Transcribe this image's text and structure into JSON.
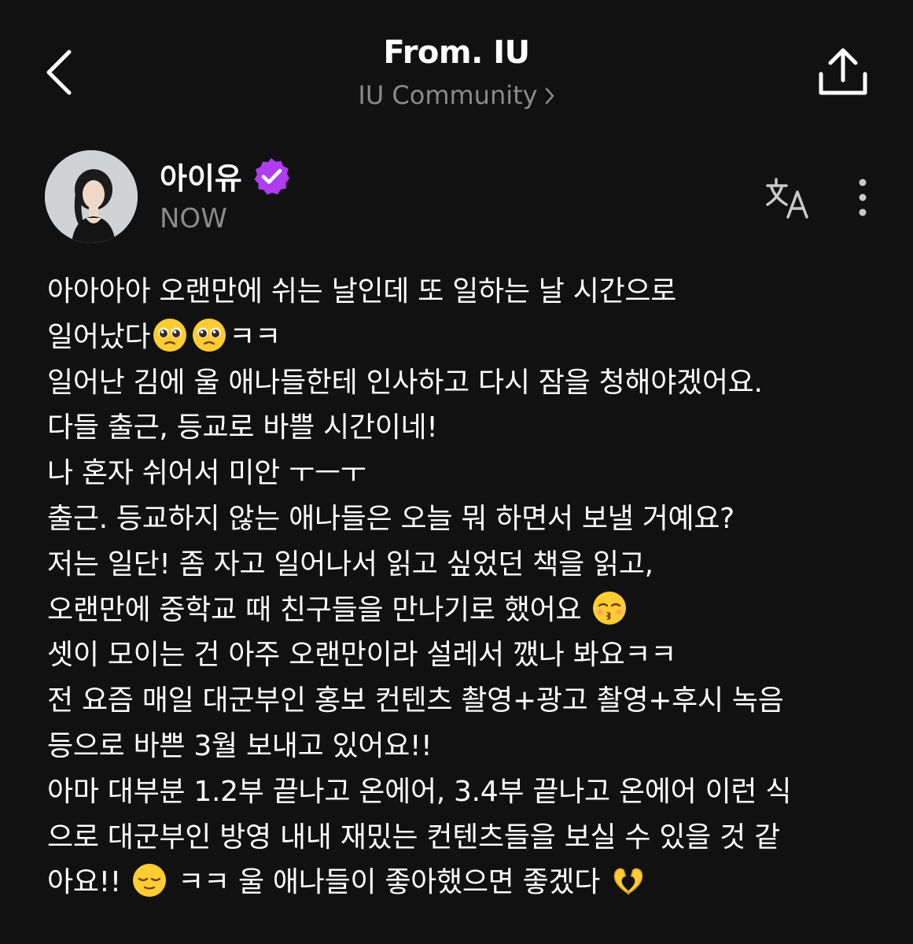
{
  "header": {
    "title": "From. IU",
    "subtitle": "IU Community",
    "back_icon": "chevron-left-icon",
    "share_icon": "share-icon"
  },
  "post": {
    "author": "아이유",
    "time": "NOW",
    "verified_color": "#b03cf0",
    "lines": [
      {
        "segments": [
          "아아아아 오랜만에 쉬는 날인데 또 일하는 날 시간으로"
        ]
      },
      {
        "segments": [
          "일어났다",
          "🥹",
          "🥹",
          "ㅋㅋ"
        ]
      },
      {
        "segments": [
          "일어난 김에 울 애나들한테 인사하고 다시 잠을 청해야겠어요."
        ]
      },
      {
        "segments": [
          "다들 출근, 등교로 바쁠 시간이네!"
        ]
      },
      {
        "segments": [
          "나 혼자 쉬어서 미안 ㅜㅡㅜ"
        ]
      },
      {
        "segments": [
          "출근. 등교하지 않는 애나들은 오늘 뭐 하면서 보낼 거예요?"
        ]
      },
      {
        "segments": [
          "저는 일단! 좀 자고 일어나서 읽고 싶었던 책을 읽고,"
        ]
      },
      {
        "segments": [
          "오랜만에 중학교 때 친구들을 만나기로 했어요 ",
          "😚"
        ]
      },
      {
        "segments": [
          "셋이 모이는 건 아주 오랜만이라 설레서 깼나 봐요ㅋㅋ"
        ]
      },
      {
        "segments": [
          "전 요즘 매일 대군부인 홍보 컨텐츠 촬영+광고 촬영+후시 녹음"
        ]
      },
      {
        "segments": [
          "등으로 바쁜 3월 보내고 있어요!!"
        ]
      },
      {
        "segments": [
          "아마 대부분 1.2부 끝나고 온에어, 3.4부 끝나고 온에어 이런 식"
        ]
      },
      {
        "segments": [
          "으로 대군부인 방영 내내 재밌는 컨텐츠들을 보실 수 있을 것 같"
        ]
      },
      {
        "segments": [
          "아요!! ",
          "😌",
          " ㅋㅋ 울 애나들이 좋아했으면 좋겠다 ",
          "🫶"
        ]
      }
    ]
  },
  "actions": {
    "translate_icon": "translate-icon",
    "more_icon": "more-vertical-icon"
  }
}
